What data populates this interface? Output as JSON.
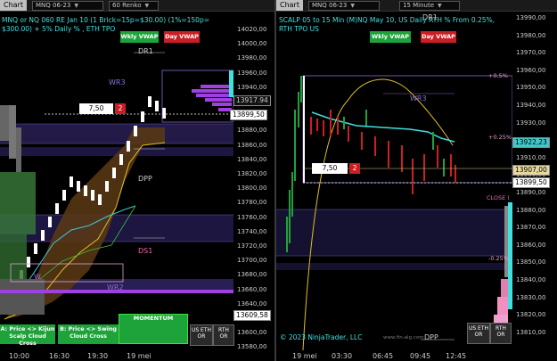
{
  "left": {
    "toolbar": {
      "chart_label": "Chart",
      "instrument": "MNQ 06-23",
      "interval": "60 Renko"
    },
    "header_line1": "MNQ or NQ 060 RE Jan 10 (1 Brick=15p=$30.00) (1%=150p=",
    "header_line2": "$300.00) + 5% Daily % , ETH TPO",
    "buttons": {
      "wkly_vwap": "Wkly VWAP",
      "day_vwap": "Day VWAP"
    },
    "labels": {
      "dr1": "DR1",
      "wr3": "WR3",
      "dpp": "DPP",
      "ds1": "DS1",
      "wr2": "WR2",
      "wr_left": "W"
    },
    "order_box": {
      "qty": "7,50",
      "count": "2"
    },
    "price_tags": {
      "p1": "13917.94",
      "p2": "13899,50",
      "p3": "13609,58"
    },
    "axis_ticks": [
      "14020,00",
      "14000,00",
      "13980,00",
      "13960,00",
      "13940,00",
      "13920,00",
      "13900,00",
      "13880,00",
      "13860,00",
      "13840,00",
      "13820,00",
      "13800,00",
      "13780,00",
      "13760,00",
      "13740,00",
      "13720,00",
      "13700,00",
      "13680,00",
      "13660,00",
      "13640,00",
      "13620,00",
      "13600,00",
      "13580,00"
    ],
    "time_ticks": [
      "10:00",
      "16:30",
      "19:30",
      "19 mei"
    ],
    "bottom_boxes": {
      "a": "A: Price <> Kijun\nScalp Cloud Cross",
      "b": "B: Price <> Swing\nCloud Cross",
      "momentum": "MOMENTUM",
      "us_eth": "US ETH\nOR",
      "rth": "RTH\nOR"
    }
  },
  "right": {
    "toolbar": {
      "chart_label": "Chart",
      "instrument": "MNQ 06-23",
      "interval": "15 Minute"
    },
    "header_line1": "SCALP 05 to 15 Min (M)NQ May 10, US Daily RTH % From 0.25%,",
    "header_line2": "RTH TPO US",
    "buttons": {
      "wkly_vwap": "Wkly VWAP",
      "day_vwap": "Day VWAP"
    },
    "labels": {
      "dr1": "DR1",
      "wr3": "WR3",
      "dpp": "DPP",
      "close": "CLOSE (",
      "pct_p05": "+0.5%",
      "pct_p025": "+0.25%",
      "pct_m025": "-0.25%"
    },
    "order_box": {
      "qty": "7,50",
      "count": "2"
    },
    "price_tags": {
      "p1": "13922,23",
      "p2": "13907,00",
      "p3": "13899,50"
    },
    "axis_ticks": [
      "13990,00",
      "13980,00",
      "13970,00",
      "13960,00",
      "13950,00",
      "13940,00",
      "13930,00",
      "13920,00",
      "13910,00",
      "13900,00",
      "13890,00",
      "13880,00",
      "13870,00",
      "13860,00",
      "13850,00",
      "13840,00",
      "13830,00",
      "13820,00",
      "13810,00"
    ],
    "time_ticks": [
      "19 mei",
      "03:30",
      "06:45",
      "09:45",
      "12:45"
    ],
    "copyright": "© 2023 NinjaTrader, LLC",
    "site": "www.fin-alg.com",
    "bottom_boxes": {
      "us_eth": "US ETH\nOR",
      "rth": "RTH\nOR"
    }
  },
  "colors": {
    "up": "#ffffff",
    "down": "#cc2020",
    "green": "#1ea23a",
    "red": "#c81f25",
    "cyan": "#40e0e0",
    "purple": "#a040e0",
    "yellow": "#e0c020",
    "band": "#2a1f55"
  }
}
